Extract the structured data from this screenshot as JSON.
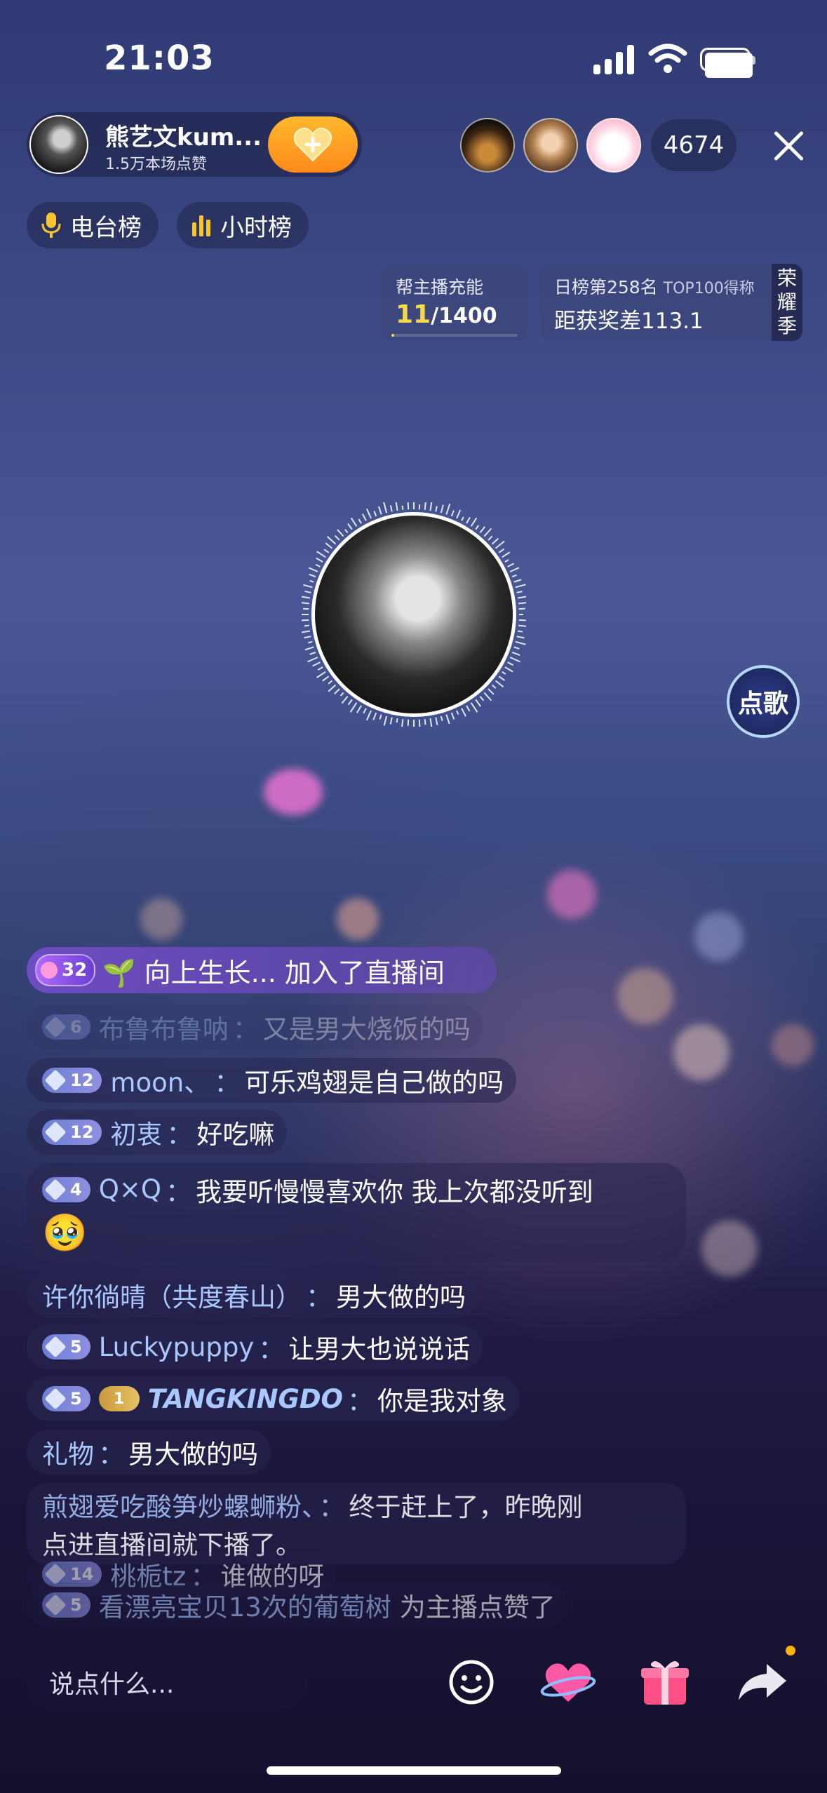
{
  "status_bar": {
    "time": "21:03"
  },
  "host": {
    "name": "熊艺文kum...",
    "likes": "1.5万本场点赞"
  },
  "viewer_count": "4674",
  "chips": [
    "电台榜",
    "小时榜"
  ],
  "panels": {
    "charge": {
      "title": "帮主播充能",
      "current": "11",
      "total": "/1400",
      "progress": 0.008
    },
    "rank": {
      "title": "日榜第258名",
      "tag": "TOP100得称",
      "gap": "距获奖差113.1",
      "season": "荣耀季"
    }
  },
  "song_button": "点歌",
  "join_message": {
    "level": "32",
    "text": "🌱 向上生长... 加入了直播间"
  },
  "chat": [
    {
      "level": "6",
      "name": "布鲁布鲁呐",
      "sep": "：",
      "text": "又是男大烧饭的吗",
      "faded": true
    },
    {
      "level": "12",
      "name": "moon、",
      "sep": "：",
      "text": "可乐鸡翅是自己做的吗"
    },
    {
      "level": "12",
      "name": "初衷",
      "sep": "：",
      "text": "好吃嘛"
    },
    {
      "level": "4",
      "name": "Q×Q",
      "sep": "：",
      "text": "我要听慢慢喜欢你 我上次都没听到",
      "emoji": "🥹"
    },
    {
      "level": "",
      "name": "许你徜晴（共度春山）",
      "sep": "：",
      "text": "男大做的吗"
    },
    {
      "level": "5",
      "name": "Luckypuppy",
      "sep": "：",
      "text": "让男大也说说话"
    },
    {
      "level": "5",
      "fan_level": "1",
      "name": "TANGKINGDO",
      "sep": "：",
      "text": "你是我对象"
    },
    {
      "level": "",
      "name": "礼物",
      "sep": "：",
      "text": "男大做的吗"
    },
    {
      "level": "",
      "name": "煎翅爱吃酸笋炒螺蛳粉、",
      "sep": "：",
      "text": "终于赶上了，昨晚刚",
      "text2": "点进直播间就下播了。"
    },
    {
      "level": "14",
      "name": "桃栀tz",
      "sep": "：",
      "text": "谁做的呀"
    },
    {
      "level": "5",
      "name": "看漂亮宝贝13次的葡萄树",
      "sep": " ",
      "text": "为主播点赞了"
    }
  ],
  "input": {
    "placeholder": "说点什么..."
  },
  "icons": [
    "signal-icon",
    "wifi-icon",
    "battery-icon",
    "heart-plus-icon",
    "close-icon",
    "microphone-icon",
    "bar-chart-icon",
    "emoji-icon",
    "heart-planet-icon",
    "gift-icon",
    "share-icon"
  ]
}
